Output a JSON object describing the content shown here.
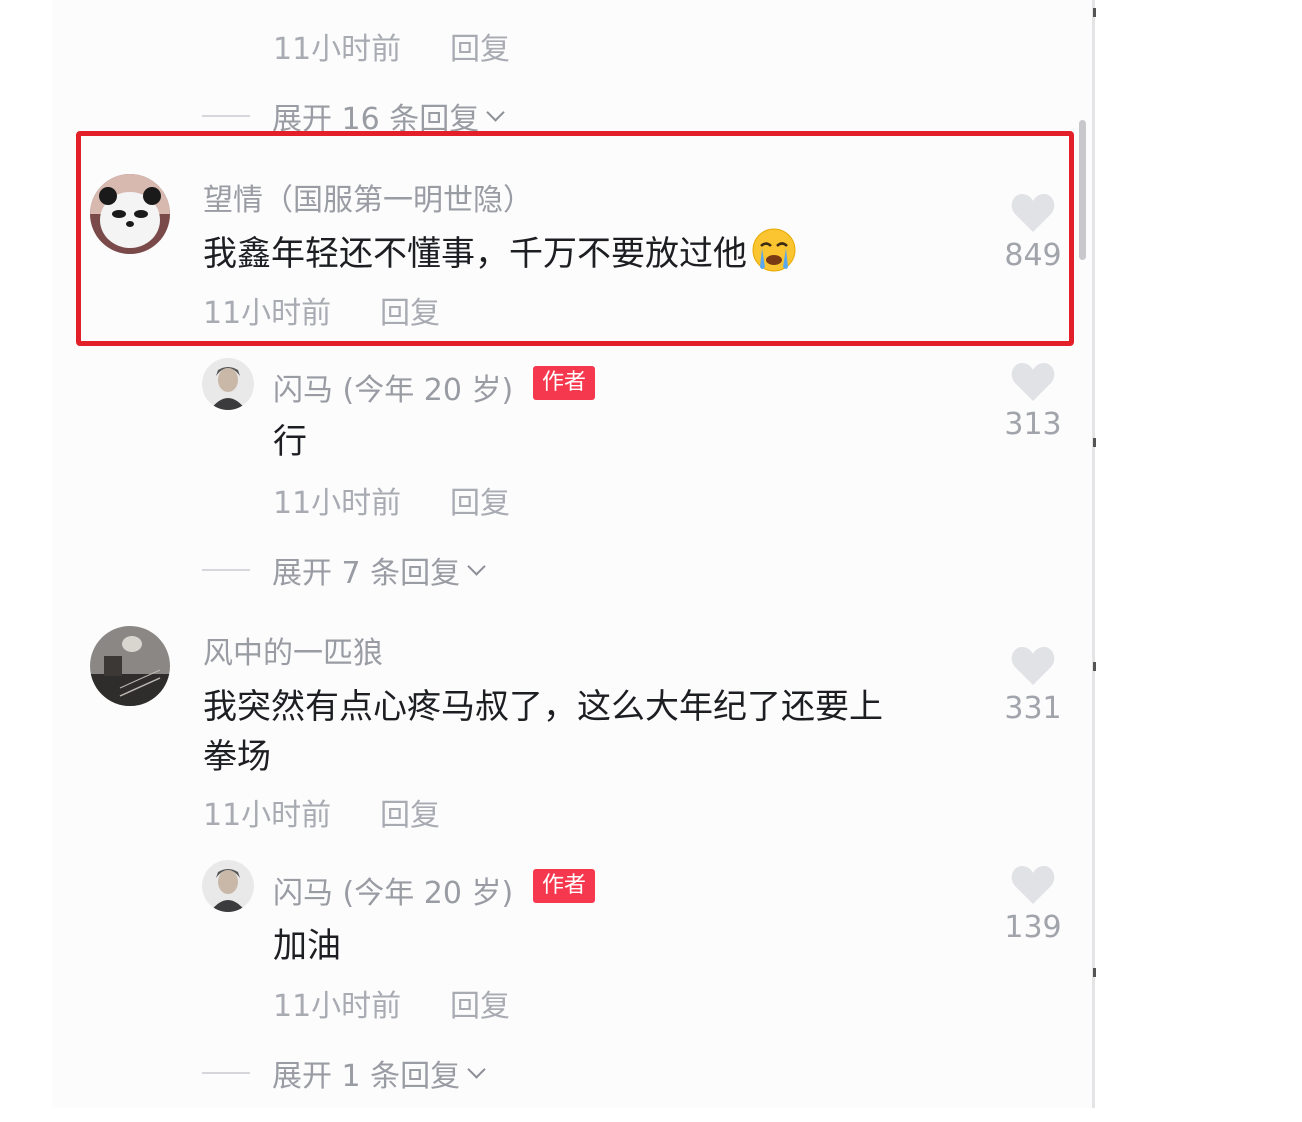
{
  "colors": {
    "highlight_border": "#e3202a",
    "author_badge": "#f5384d",
    "meta_text": "#a9abb3",
    "body_text": "#1d1e22"
  },
  "top_reply": {
    "time": "11小时前",
    "reply": "回复",
    "expand": "展开 16 条回复"
  },
  "comments": [
    {
      "name": "望情（国服第一明世隐）",
      "text": "我鑫年轻还不懂事，千万不要放过他",
      "emoji": "crying-face-icon",
      "time": "11小时前",
      "reply": "回复",
      "likes": "849",
      "highlighted": true,
      "author_reply": {
        "name": "闪马 (今年 20 岁)",
        "badge": "作者",
        "text": "行",
        "time": "11小时前",
        "reply": "回复",
        "likes": "313",
        "expand": "展开 7 条回复"
      }
    },
    {
      "name": "风中的一匹狼",
      "text_line1": "我突然有点心疼马叔了，这么大年纪了还要上",
      "text_line2": "拳场",
      "time": "11小时前",
      "reply": "回复",
      "likes": "331",
      "author_reply": {
        "name": "闪马 (今年 20 岁)",
        "badge": "作者",
        "text": "加油",
        "time": "11小时前",
        "reply": "回复",
        "likes": "139",
        "expand": "展开 1 条回复"
      }
    }
  ]
}
